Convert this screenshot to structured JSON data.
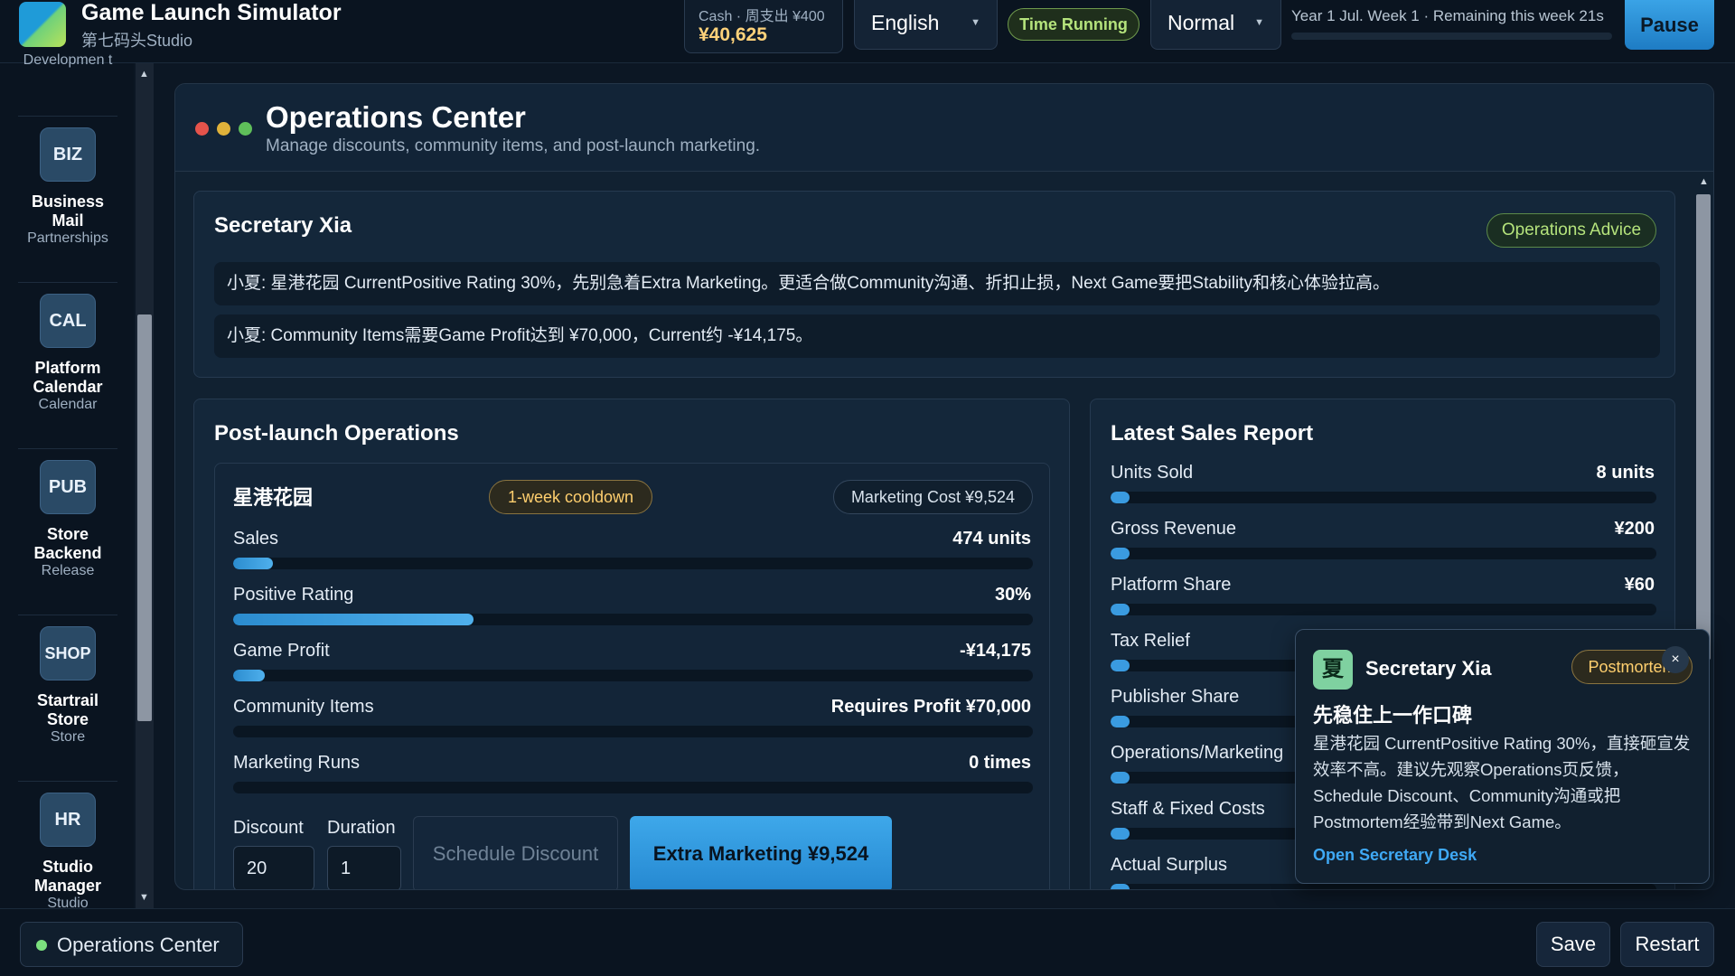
{
  "header": {
    "app_title": "Game Launch Simulator",
    "studio": "第七码头Studio",
    "cash_label": "Cash · 周支出 ¥400",
    "cash_value": "¥40,625",
    "language": "English",
    "time_status": "Time Running",
    "speed": "Normal",
    "week_text": "Year 1 Jul. Week 1 · Remaining this week 21s",
    "pause_label": "Pause"
  },
  "sidebar": {
    "partial_label": "Developmen t",
    "items": [
      {
        "icon": "BIZ",
        "label": "Business Mail",
        "sub": "Partnerships"
      },
      {
        "icon": "CAL",
        "label": "Platform Calendar",
        "sub": "Calendar"
      },
      {
        "icon": "PUB",
        "label": "Store Backend",
        "sub": "Release"
      },
      {
        "icon": "SHOP",
        "label": "Startrail Store",
        "sub": "Store"
      },
      {
        "icon": "HR",
        "label": "Studio Manager",
        "sub": "Studio"
      }
    ]
  },
  "panel": {
    "title": "Operations Center",
    "subtitle": "Manage discounts, community items, and post-launch marketing.",
    "window_dot_colors": [
      "#e5534b",
      "#e0b23a",
      "#5fbf5a"
    ]
  },
  "secretary": {
    "title": "Secretary Xia",
    "advice_label": "Operations Advice",
    "messages": [
      "小夏: 星港花园 CurrentPositive Rating 30%，先别急着Extra Marketing。更适合做Community沟通、折扣止损，Next Game要把Stability和核心体验拉高。",
      "小夏: Community Items需要Game Profit达到 ¥70,000，Current约 -¥14,175。"
    ]
  },
  "operations": {
    "title": "Post-launch Operations",
    "game_name": "星港花园",
    "cooldown": "1-week cooldown",
    "marketing_cost": "Marketing Cost ¥9,524",
    "stats": [
      {
        "label": "Sales",
        "value": "474 units",
        "fill": 0.05
      },
      {
        "label": "Positive Rating",
        "value": "30%",
        "fill": 0.3
      },
      {
        "label": "Game Profit",
        "value": "-¥14,175",
        "fill": 0.04
      },
      {
        "label": "Community Items",
        "value": "Requires Profit ¥70,000",
        "fill": 0
      },
      {
        "label": "Marketing Runs",
        "value": "0 times",
        "fill": 0
      }
    ],
    "discount_label": "Discount",
    "discount_value": "20",
    "duration_label": "Duration",
    "duration_value": "1",
    "schedule_label": "Schedule Discount",
    "marketing_label": "Extra Marketing ¥9,524"
  },
  "sales_report": {
    "title": "Latest Sales Report",
    "rows": [
      {
        "label": "Units Sold",
        "value": "8 units",
        "fill": 0.03
      },
      {
        "label": "Gross Revenue",
        "value": "¥200",
        "fill": 0.03
      },
      {
        "label": "Platform Share",
        "value": "¥60",
        "fill": 0.03
      },
      {
        "label": "Tax Relief",
        "value": "",
        "fill": 0.03
      },
      {
        "label": "Publisher Share",
        "value": "",
        "fill": 0.03
      },
      {
        "label": "Operations/Marketing",
        "value": "",
        "fill": 0.03
      },
      {
        "label": "Staff & Fixed Costs",
        "value": "",
        "fill": 0.03
      },
      {
        "label": "Actual Surplus",
        "value": "",
        "fill": 0.03
      }
    ]
  },
  "popup": {
    "avatar": "夏",
    "name": "Secretary Xia",
    "tag": "Postmortem",
    "close": "×",
    "headline": "先稳住上一作口碑",
    "body": "星港花园 CurrentPositive Rating 30%，直接砸宣发效率不高。建议先观察Operations页反馈，Schedule Discount、Community沟通或把Postmortem经验带到Next Game。",
    "link": "Open Secretary Desk"
  },
  "footer": {
    "status": "Operations Center",
    "save_label": "Save",
    "restart_label": "Restart"
  }
}
